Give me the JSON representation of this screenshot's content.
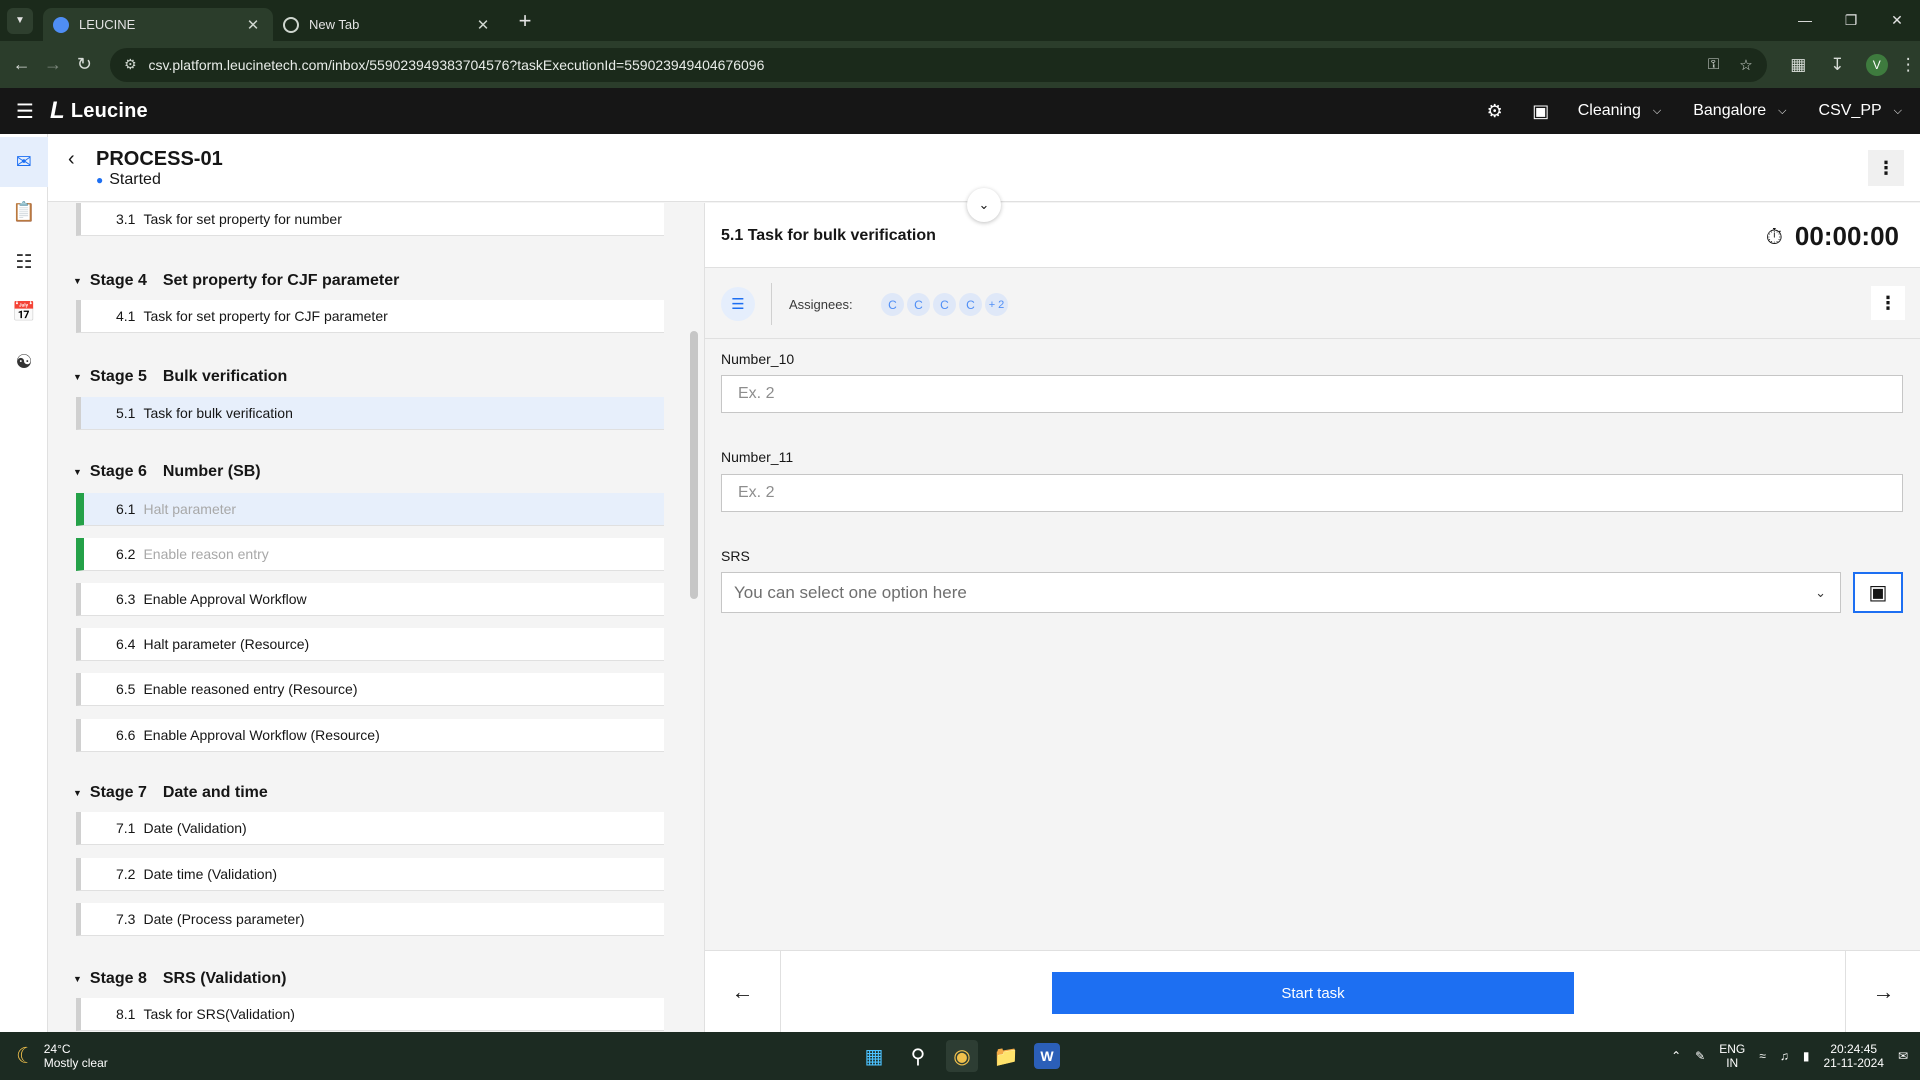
{
  "browser": {
    "tabs": [
      {
        "title": "LEUCINE",
        "active": true
      },
      {
        "title": "New Tab",
        "active": false
      }
    ],
    "url": "csv.platform.leucinetech.com/inbox/559023949383704576?taskExecutionId=559023949404676096",
    "profile_initial": "V"
  },
  "app": {
    "brand": "Leucine",
    "use_case": "Cleaning",
    "facility": "Bangalore",
    "user": "CSV_PP"
  },
  "process": {
    "name": "PROCESS-01",
    "status": "Started"
  },
  "stages": [
    {
      "label": "Stage 4",
      "name": "Set property for CJF parameter"
    },
    {
      "label": "Stage 5",
      "name": "Bulk verification"
    },
    {
      "label": "Stage 6",
      "name": "Number (SB)"
    },
    {
      "label": "Stage 7",
      "name": "Date and time"
    },
    {
      "label": "Stage 8",
      "name": "SRS (Validation)"
    }
  ],
  "tasks": [
    {
      "num": "3.1",
      "label": "Task for set property for number"
    },
    {
      "num": "4.1",
      "label": "Task for set property for CJF parameter"
    },
    {
      "num": "5.1",
      "label": "Task for bulk verification"
    },
    {
      "num": "6.1",
      "label": "Halt parameter"
    },
    {
      "num": "6.2",
      "label": "Enable reason entry"
    },
    {
      "num": "6.3",
      "label": "Enable Approval Workflow"
    },
    {
      "num": "6.4",
      "label": "Halt parameter (Resource)"
    },
    {
      "num": "6.5",
      "label": "Enable reasoned entry (Resource)"
    },
    {
      "num": "6.6",
      "label": "Enable Approval Workflow (Resource)"
    },
    {
      "num": "7.1",
      "label": "Date (Validation)"
    },
    {
      "num": "7.2",
      "label": "Date time (Validation)"
    },
    {
      "num": "7.3",
      "label": "Date (Process parameter)"
    },
    {
      "num": "8.1",
      "label": "Task for SRS(Validation)"
    }
  ],
  "task_panel": {
    "title": "5.1 Task for bulk verification",
    "timer": "00:00:00",
    "assignees_label": "Assignees:",
    "assignees": [
      "C",
      "C",
      "C",
      "C",
      "+ 2"
    ],
    "fields": [
      {
        "label": "Number_10",
        "placeholder": "Ex. 2"
      },
      {
        "label": "Number_11",
        "placeholder": "Ex. 2"
      }
    ],
    "select": {
      "label": "SRS",
      "placeholder": "You can select one option here"
    },
    "start_label": "Start task"
  },
  "taskbar": {
    "temperature": "24°C",
    "weather": "Mostly clear",
    "lang_top": "ENG",
    "lang_bottom": "IN",
    "time": "20:24:45",
    "date": "21-11-2024"
  },
  "colors": {
    "primary": "#1d6ff2",
    "success": "#24a148",
    "header_bg": "#161616"
  }
}
